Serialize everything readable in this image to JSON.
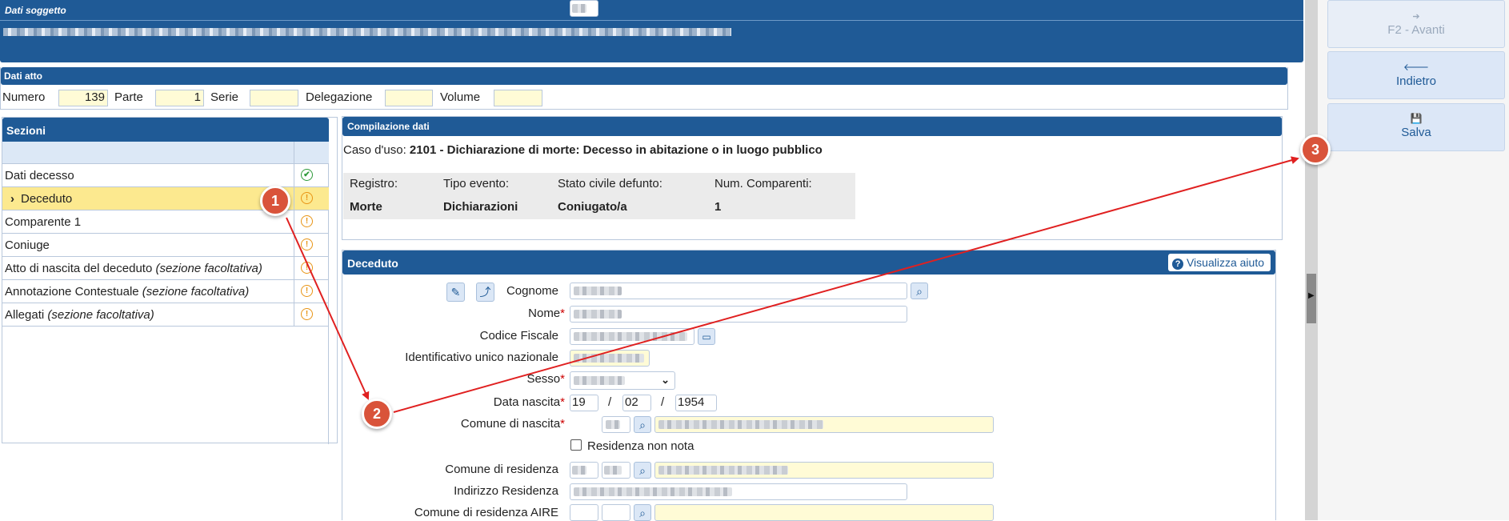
{
  "soggetto": {
    "title": "Dati soggetto"
  },
  "atto": {
    "title": "Dati atto",
    "numero_label": "Numero",
    "numero_value": "139",
    "parte_label": "Parte",
    "parte_value": "1",
    "serie_label": "Serie",
    "serie_value": "",
    "delegazione_label": "Delegazione",
    "delegazione_value": "",
    "volume_label": "Volume",
    "volume_value": ""
  },
  "sezioni": {
    "title": "Sezioni",
    "items": [
      {
        "label": "Dati decesso",
        "optional": "",
        "status": "✔"
      },
      {
        "label": "Deceduto",
        "optional": "",
        "status": "!"
      },
      {
        "label": "Comparente 1",
        "optional": "",
        "status": "!"
      },
      {
        "label": "Coniuge",
        "optional": "",
        "status": "!"
      },
      {
        "label": "Atto di nascita del deceduto ",
        "optional": "(sezione facoltativa)",
        "status": "!"
      },
      {
        "label": "Annotazione Contestuale ",
        "optional": "(sezione facoltativa)",
        "status": "!"
      },
      {
        "label": "Allegati ",
        "optional": "(sezione facoltativa)",
        "status": "!"
      }
    ],
    "expand_glyph": "›"
  },
  "compilazione": {
    "title": "Compilazione dati",
    "caso_label": "Caso d'uso:",
    "caso_value": "2101 - Dichiarazione di morte: Decesso in abitazione o in luogo pubblico",
    "headers": [
      "Registro:",
      "Tipo evento:",
      "Stato civile defunto:",
      "Num. Comparenti:"
    ],
    "values": [
      "Morte",
      "Dichiarazioni",
      "Coniugato/a",
      "1"
    ]
  },
  "deceduto": {
    "title": "Deceduto",
    "help_label": "Visualizza aiuto",
    "cognome_label": "Cognome",
    "nome_label": "Nome",
    "cf_label": "Codice Fiscale",
    "idun_label": "Identificativo unico nazionale",
    "sesso_label": "Sesso",
    "data_nascita_label": "Data nascita",
    "data_day": "19",
    "data_month": "02",
    "data_year": "1954",
    "date_sep": "/",
    "comune_nascita_label": "Comune di nascita",
    "residenza_non_nota_label": "Residenza non nota",
    "comune_residenza_label": "Comune di residenza",
    "indirizzo_label": "Indirizzo Residenza",
    "comune_aire_label": "Comune di residenza AIRE",
    "required_mark": "*"
  },
  "actions": {
    "avanti": {
      "icon": "➔",
      "label": "F2 - Avanti"
    },
    "indietro": {
      "icon": "🡐",
      "label": "Indietro"
    },
    "salva": {
      "icon": "💾",
      "label": "Salva"
    }
  },
  "markers": [
    "1",
    "2",
    "3"
  ],
  "colors": {
    "header": "#1f5a96",
    "marker": "#d9533a",
    "arrow": "#e02020",
    "selected_row": "#fce98f"
  }
}
